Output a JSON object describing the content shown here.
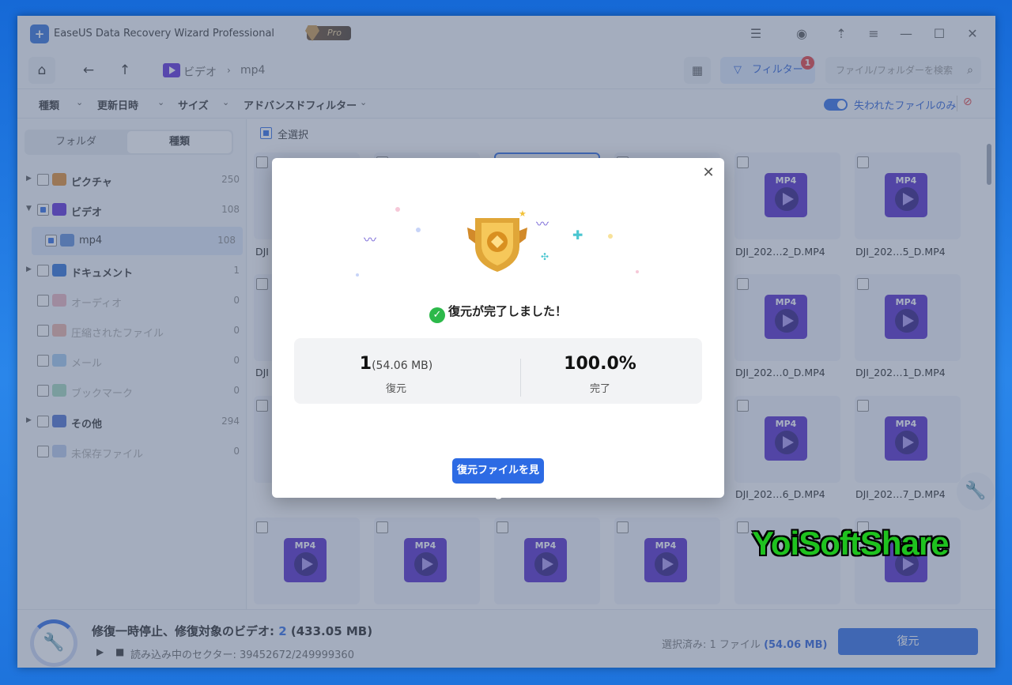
{
  "app": {
    "title": "EaseUS Data Recovery Wizard Professional",
    "pro_badge": "Pro"
  },
  "toolbar": {
    "back": "←",
    "up": "↑",
    "breadcrumb": [
      "ビデオ",
      "mp4"
    ],
    "filter_label": "フィルター",
    "filter_badge": "1",
    "search_placeholder": "ファイル/フォルダーを検索"
  },
  "filters": {
    "options": [
      "種類",
      "更新日時",
      "サイズ",
      "アドバンスドフィルター"
    ],
    "toggle_label": "失われたファイルのみ",
    "toggle_on": true
  },
  "sidebar": {
    "tabs": [
      "フォルダ",
      "種類"
    ],
    "active_tab": "種類",
    "items": [
      {
        "label": "ピクチャ",
        "count": "250",
        "icon": "picture-icon",
        "color": "#e08a2c"
      },
      {
        "label": "ビデオ",
        "count": "108",
        "icon": "video-icon",
        "color": "#5b2bd8"
      },
      {
        "label": "mp4",
        "count": "108",
        "icon": "folder-icon",
        "color": "#5b8bd8"
      },
      {
        "label": "ドキュメント",
        "count": "1",
        "icon": "document-icon",
        "color": "#2a6fd6"
      },
      {
        "label": "オーディオ",
        "count": "0",
        "icon": "audio-icon",
        "color": "#e06070"
      },
      {
        "label": "圧縮されたファイル",
        "count": "0",
        "icon": "archive-icon",
        "color": "#e05a3c"
      },
      {
        "label": "メール",
        "count": "0",
        "icon": "mail-icon",
        "color": "#3a8de0"
      },
      {
        "label": "ブックマーク",
        "count": "0",
        "icon": "bookmark-icon",
        "color": "#3cb06a"
      },
      {
        "label": "その他",
        "count": "294",
        "icon": "other-icon",
        "color": "#4a6fcf"
      },
      {
        "label": "未保存ファイル",
        "count": "0",
        "icon": "unsaved-icon",
        "color": "#6a8fd8"
      }
    ]
  },
  "content": {
    "select_all": "全選択",
    "mp4_label": "MP4",
    "files": [
      {
        "name": "DJI_202…2_D.MP4"
      },
      {
        "name": "DJI_202…5_D.MP4"
      },
      {
        "name": "DJI_202…0_D.MP4"
      },
      {
        "name": "DJI_202…1_D.MP4"
      },
      {
        "name": "DJI_202…6_D.MP4"
      },
      {
        "name": "DJI_202…7_D.MP4"
      }
    ],
    "partial_name": "DJI"
  },
  "bottom": {
    "repair_prefix": "修復一時停止、修復対象のビデオ: ",
    "repair_count": "2",
    "repair_size": " (433.05 MB)",
    "sector_text": "読み込み中のセクター: 39452672/249999360",
    "selected_prefix": "選択済み: 1 ファイル ",
    "selected_size": "(54.06 MB)",
    "recover_button": "復元"
  },
  "modal": {
    "title": "復元が完了しました！",
    "count": "1",
    "size": "(54.06 MB)",
    "count_label": "復元",
    "percent": "100.0%",
    "percent_label": "完了",
    "button": "復元ファイルを見る"
  },
  "watermark": "YoiSoftShare",
  "colors": {
    "accent": "#2d6be4",
    "video_purple": "#5127c9",
    "success": "#2cb94a",
    "badge_red": "#e53b3b"
  }
}
